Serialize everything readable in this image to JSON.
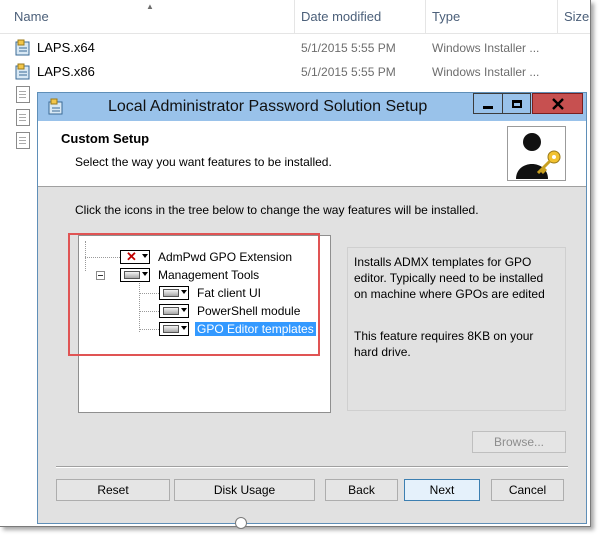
{
  "explorer": {
    "columns": {
      "name": "Name",
      "date_modified": "Date modified",
      "type": "Type",
      "size": "Size"
    },
    "files": [
      {
        "name": "LAPS.x64",
        "date": "5/1/2015 5:55 PM",
        "type": "Windows Installer ...",
        "icon": "msi-installer-icon"
      },
      {
        "name": "LAPS.x86",
        "date": "5/1/2015 5:55 PM",
        "type": "Windows Installer ...",
        "icon": "msi-installer-icon"
      }
    ]
  },
  "dialog": {
    "title": "Local Administrator Password Solution Setup",
    "heading": "Custom Setup",
    "subheading": "Select the way you want features to be installed.",
    "instructions": "Click the icons in the tree below to change the way features will be installed.",
    "tree": [
      {
        "label": "AdmPwd GPO Extension",
        "state": "not-installed-icon"
      },
      {
        "label": "Management Tools",
        "state": "hard-drive-icon"
      },
      {
        "label": "Fat client UI",
        "state": "hard-drive-icon"
      },
      {
        "label": "PowerShell module",
        "state": "hard-drive-icon"
      },
      {
        "label": "GPO Editor templates",
        "state": "hard-drive-icon",
        "selected": true
      }
    ],
    "description": "Installs ADMX templates for GPO\neditor. Typically need to be installed\non machine where GPOs are edited",
    "requirement": "This feature requires 8KB on your\nhard drive.",
    "buttons": {
      "browse": "Browse...",
      "reset": "Reset",
      "disk_usage": "Disk Usage",
      "back": "Back",
      "next": "Next",
      "cancel": "Cancel"
    }
  },
  "colors": {
    "titlebar": "#99c2ea",
    "close": "#c75050",
    "selection": "#3399ff",
    "highlight_box": "#e05454"
  }
}
